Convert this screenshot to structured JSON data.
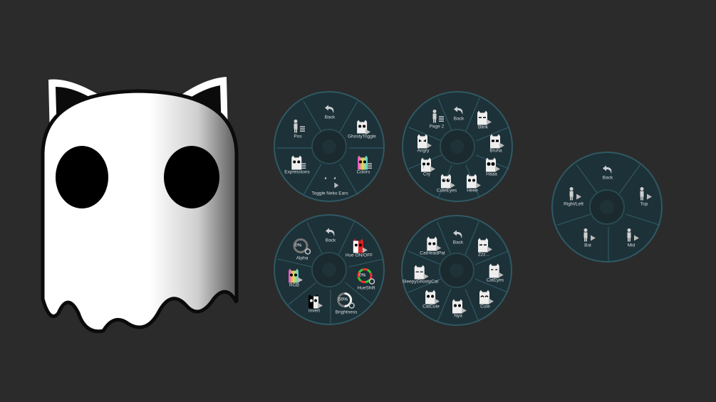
{
  "colors": {
    "background": "#2b2b2b",
    "menu_fill": "#1d3138",
    "menu_ring": "#2f5963",
    "label": "#d6dde0"
  },
  "menus": {
    "main": {
      "back": "Back",
      "pos": "Pos",
      "ghosty_toggle": "GhostyToggle",
      "expressions": "Expressions",
      "colors": "Colors",
      "toggle_ears": "Toggle Neko Ears"
    },
    "expressions": {
      "page2": "Page 2",
      "back": "Back",
      "blink": "Blink",
      "angry": "Angry",
      "bruha": "Bruha",
      "cry": "Cry",
      "haaa": "Haaa",
      "cuteeyes": "CuteEyes",
      "heee": "Heee"
    },
    "position": {
      "back": "Back",
      "rightleft": "Right/Left",
      "top": "Top",
      "bot": "Bot",
      "mid": "Mid"
    },
    "colors": {
      "alpha": "Alpha",
      "alpha_value": "0%",
      "back": "Back",
      "hue_onoff": "Hue ON/OFF",
      "rgb": "RGB",
      "hueshift": "HueShift",
      "hueshift_value": "0%",
      "invert": "Invert",
      "brightness": "Brightness",
      "brightness_value": "50%"
    },
    "page2": {
      "catheadpat": "CatHeadPat",
      "back": "Back",
      "zzz": "Zzz...",
      "sleepyghostycat": "SleepyGhostyCat",
      "cateyes": "CatEyes",
      "catcute": "CatCute",
      "cute": "Cute",
      "nya": "Nya"
    }
  }
}
